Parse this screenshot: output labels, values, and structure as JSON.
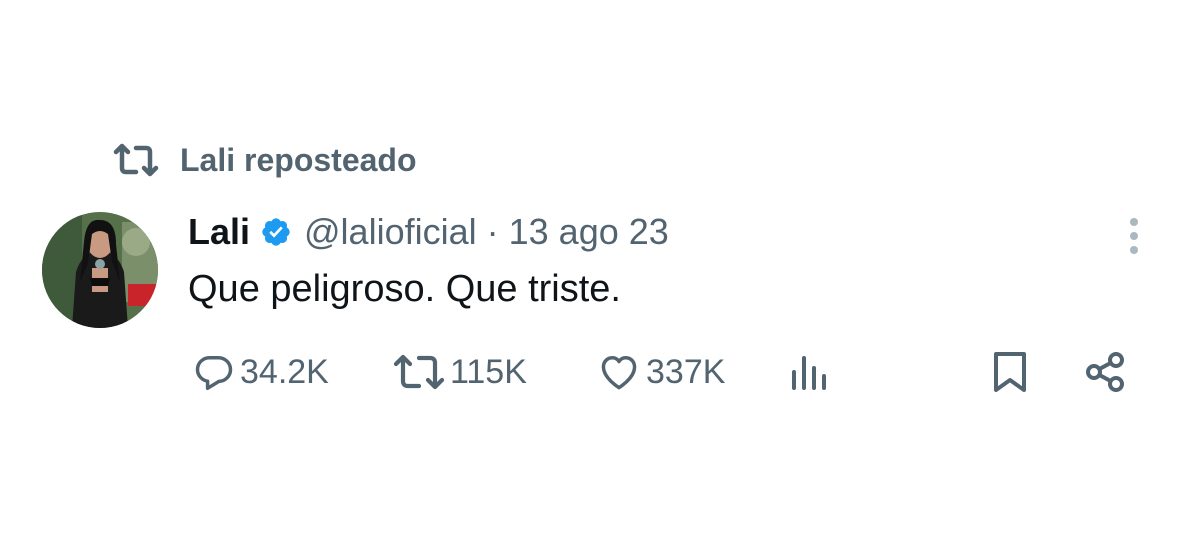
{
  "repost": {
    "label": "Lali reposteado"
  },
  "tweet": {
    "author_name": "Lali",
    "handle": "@lalioficial",
    "separator": "·",
    "date": "13 ago 23",
    "text": "Que peligroso. Que triste."
  },
  "actions": {
    "replies": "34.2K",
    "reposts": "115K",
    "likes": "337K"
  },
  "icons": {
    "repost": "repost-icon",
    "verified": "verified-badge-icon",
    "more": "more-vertical-icon",
    "reply": "reply-icon",
    "like": "heart-icon",
    "views": "views-chart-icon",
    "bookmark": "bookmark-icon",
    "share": "share-icon"
  },
  "colors": {
    "text_primary": "#0f1419",
    "text_secondary": "#536471",
    "verified": "#1d9bf0"
  }
}
